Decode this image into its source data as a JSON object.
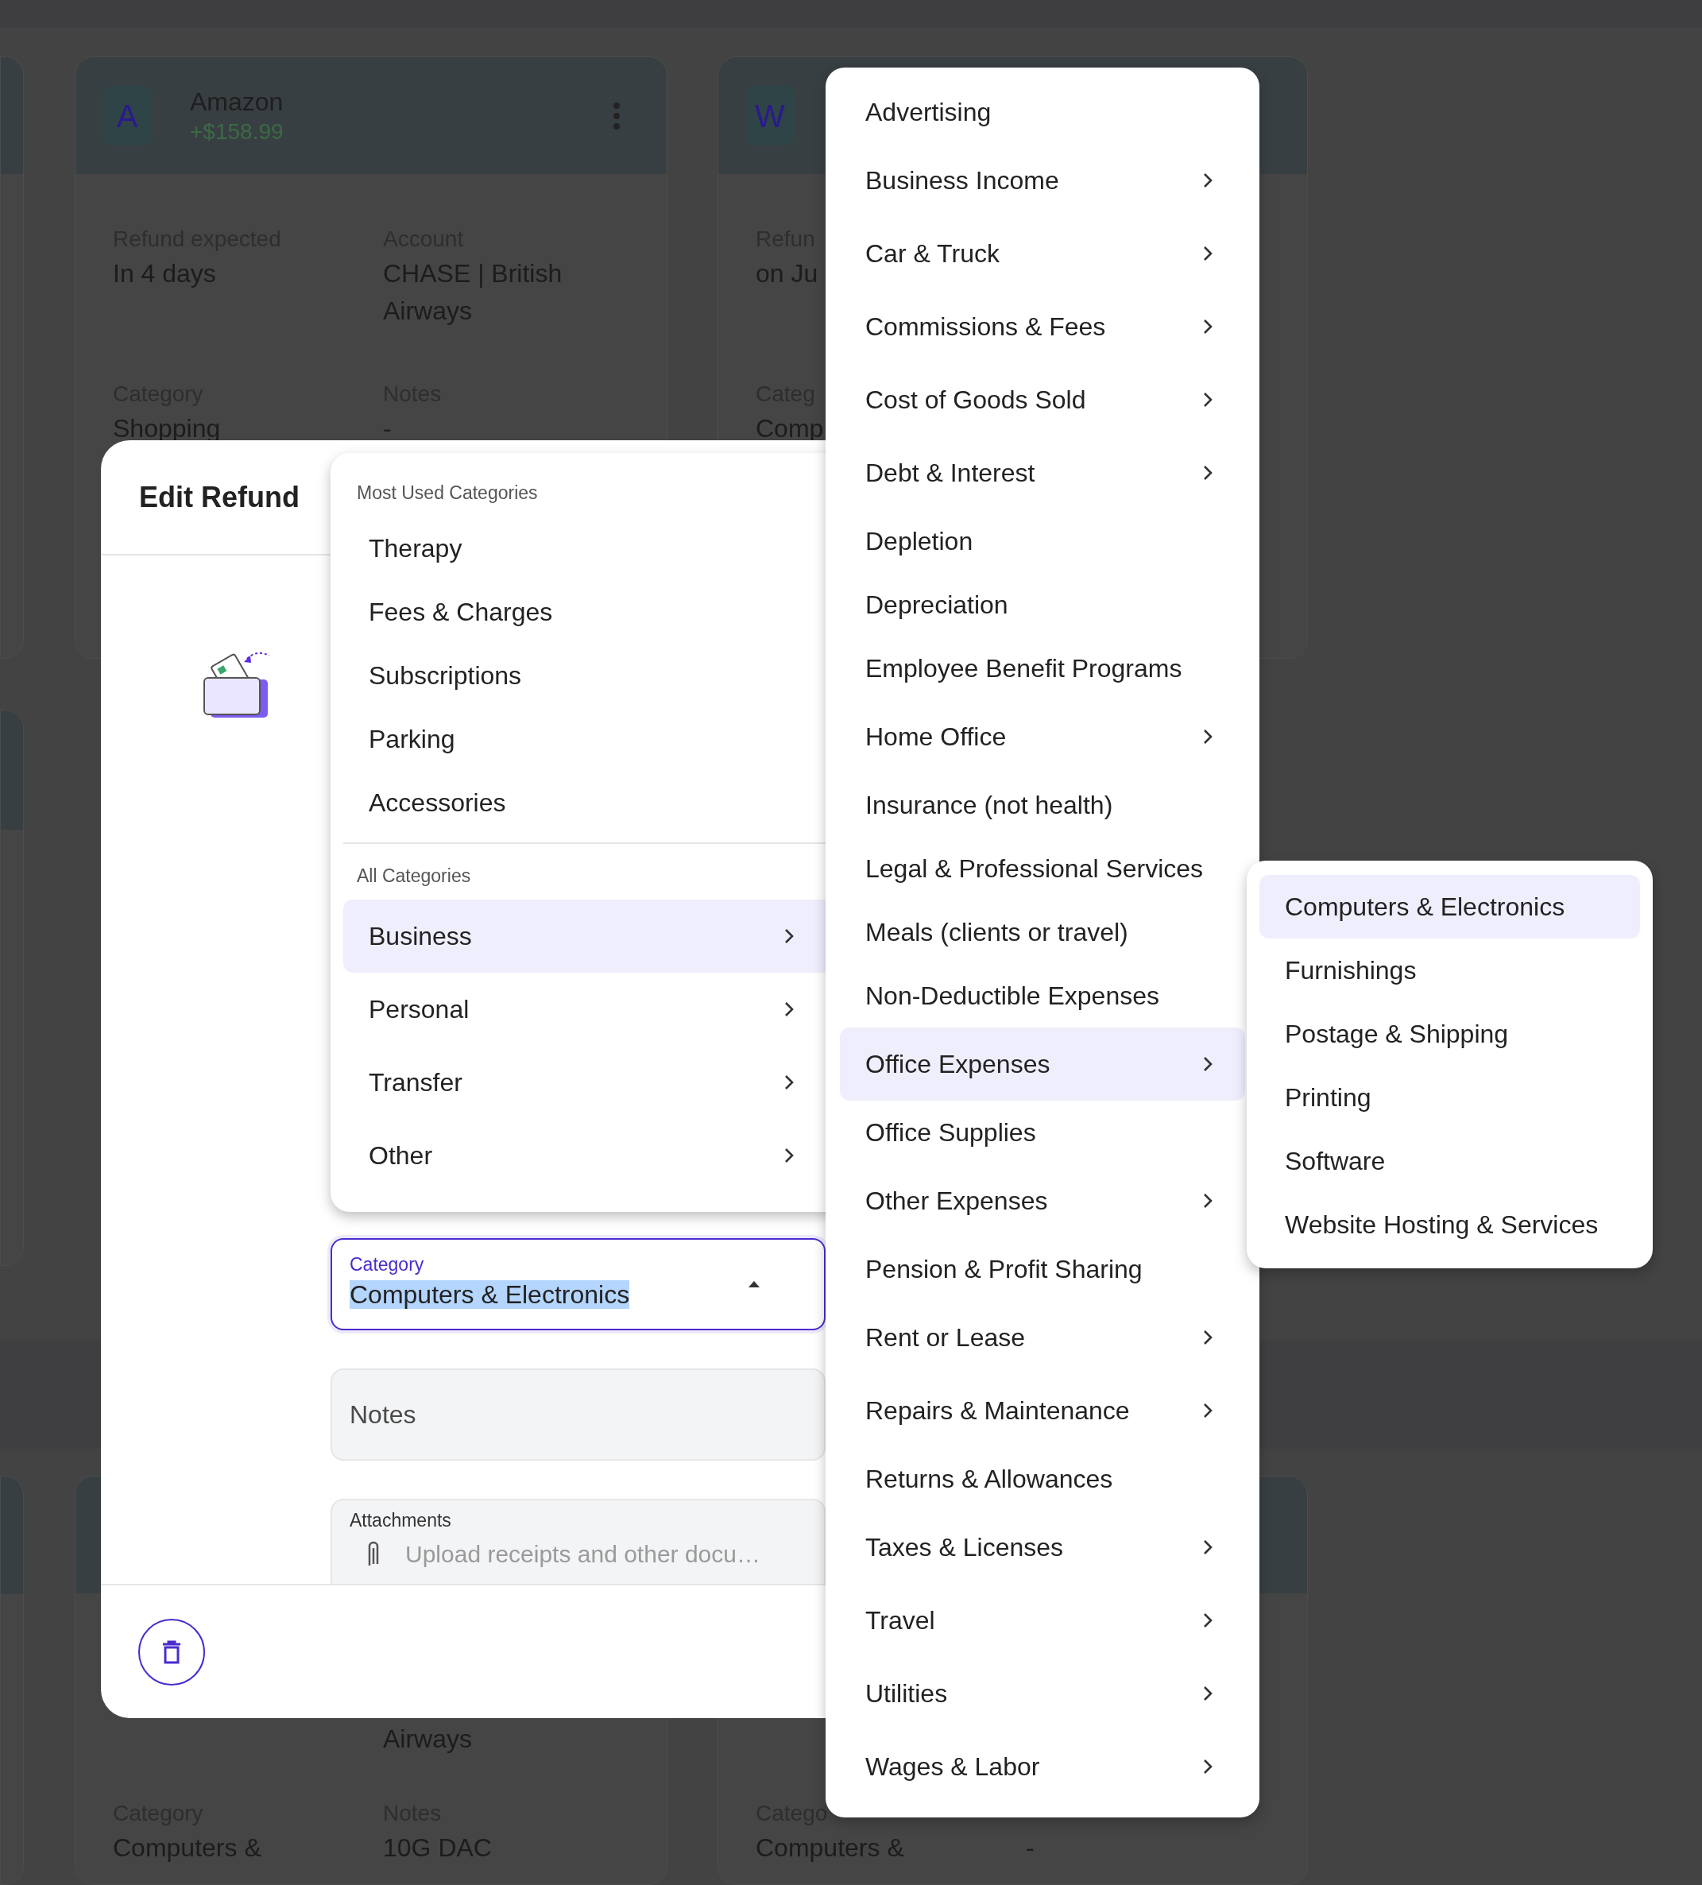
{
  "cards": [
    {
      "avatar": "A",
      "name": "Amazon",
      "amount": "+$158.99",
      "show_menu_icon": true,
      "rows": [
        [
          {
            "label": "Refund expected",
            "value": "In 4 days"
          },
          {
            "label": "Account",
            "value": "CHASE | British Airways"
          }
        ],
        [
          {
            "label": "Category",
            "value": "Shopping"
          },
          {
            "label": "Notes",
            "value": "-"
          }
        ]
      ]
    },
    {
      "avatar": "W",
      "rows": [
        [
          {
            "label": "Refun",
            "value": "on Ju"
          }
        ],
        [
          {
            "label": "Categ",
            "value": "Comp"
          }
        ]
      ]
    },
    {
      "rows": [
        [
          null,
          {
            "value": "Airways"
          }
        ],
        [
          {
            "label": "Category",
            "value": "Computers &"
          },
          {
            "label": "Notes",
            "value": "10G DAC"
          }
        ]
      ]
    },
    {
      "rows": [
        [
          null,
          null
        ],
        [
          {
            "label": "Catego",
            "value": "Computers &"
          },
          {
            "value": "-"
          }
        ]
      ]
    }
  ],
  "dialog": {
    "title": "Edit Refund",
    "category_field": {
      "label": "Category",
      "value": "Computers & Electronics",
      "text_selected": true,
      "expanded": true
    },
    "notes_field": {
      "placeholder": "Notes"
    },
    "attachments": {
      "label": "Attachments",
      "placeholder": "Upload receipts and other docu…"
    }
  },
  "category_menu": {
    "sections": [
      {
        "title": "Most Used Categories",
        "items": [
          {
            "label": "Therapy",
            "has_submenu": false,
            "selected": false
          },
          {
            "label": "Fees & Charges",
            "has_submenu": false,
            "selected": false
          },
          {
            "label": "Subscriptions",
            "has_submenu": false,
            "selected": false
          },
          {
            "label": "Parking",
            "has_submenu": false,
            "selected": false
          },
          {
            "label": "Accessories",
            "has_submenu": false,
            "selected": false
          }
        ]
      },
      {
        "title": "All Categories",
        "items": [
          {
            "label": "Business",
            "has_submenu": true,
            "selected": true
          },
          {
            "label": "Personal",
            "has_submenu": true,
            "selected": false
          },
          {
            "label": "Transfer",
            "has_submenu": true,
            "selected": false
          },
          {
            "label": "Other",
            "has_submenu": true,
            "selected": false
          }
        ]
      }
    ]
  },
  "business_menu": {
    "items": [
      {
        "label": "Advertising",
        "has_submenu": false,
        "selected": false
      },
      {
        "label": "Business Income",
        "has_submenu": true,
        "selected": false
      },
      {
        "label": "Car & Truck",
        "has_submenu": true,
        "selected": false
      },
      {
        "label": "Commissions & Fees",
        "has_submenu": true,
        "selected": false
      },
      {
        "label": "Cost of Goods Sold",
        "has_submenu": true,
        "selected": false
      },
      {
        "label": "Debt & Interest",
        "has_submenu": true,
        "selected": false
      },
      {
        "label": "Depletion",
        "has_submenu": false,
        "selected": false
      },
      {
        "label": "Depreciation",
        "has_submenu": false,
        "selected": false
      },
      {
        "label": "Employee Benefit Programs",
        "has_submenu": false,
        "selected": false
      },
      {
        "label": "Home Office",
        "has_submenu": true,
        "selected": false
      },
      {
        "label": "Insurance (not health)",
        "has_submenu": false,
        "selected": false
      },
      {
        "label": "Legal & Professional Services",
        "has_submenu": false,
        "selected": false
      },
      {
        "label": "Meals (clients or travel)",
        "has_submenu": false,
        "selected": false
      },
      {
        "label": "Non-Deductible Expenses",
        "has_submenu": false,
        "selected": false
      },
      {
        "label": "Office Expenses",
        "has_submenu": true,
        "selected": true
      },
      {
        "label": "Office Supplies",
        "has_submenu": false,
        "selected": false
      },
      {
        "label": "Other Expenses",
        "has_submenu": true,
        "selected": false
      },
      {
        "label": "Pension & Profit Sharing",
        "has_submenu": false,
        "selected": false
      },
      {
        "label": "Rent or Lease",
        "has_submenu": true,
        "selected": false
      },
      {
        "label": "Repairs & Maintenance",
        "has_submenu": true,
        "selected": false
      },
      {
        "label": "Returns & Allowances",
        "has_submenu": false,
        "selected": false
      },
      {
        "label": "Taxes & Licenses",
        "has_submenu": true,
        "selected": false
      },
      {
        "label": "Travel",
        "has_submenu": true,
        "selected": false
      },
      {
        "label": "Utilities",
        "has_submenu": true,
        "selected": false
      },
      {
        "label": "Wages & Labor",
        "has_submenu": true,
        "selected": false
      }
    ]
  },
  "office_menu": {
    "items": [
      {
        "label": "Computers & Electronics",
        "selected": true
      },
      {
        "label": "Furnishings",
        "selected": false
      },
      {
        "label": "Postage & Shipping",
        "selected": false
      },
      {
        "label": "Printing",
        "selected": false
      },
      {
        "label": "Software",
        "selected": false
      },
      {
        "label": "Website Hosting & Services",
        "selected": false
      }
    ]
  }
}
